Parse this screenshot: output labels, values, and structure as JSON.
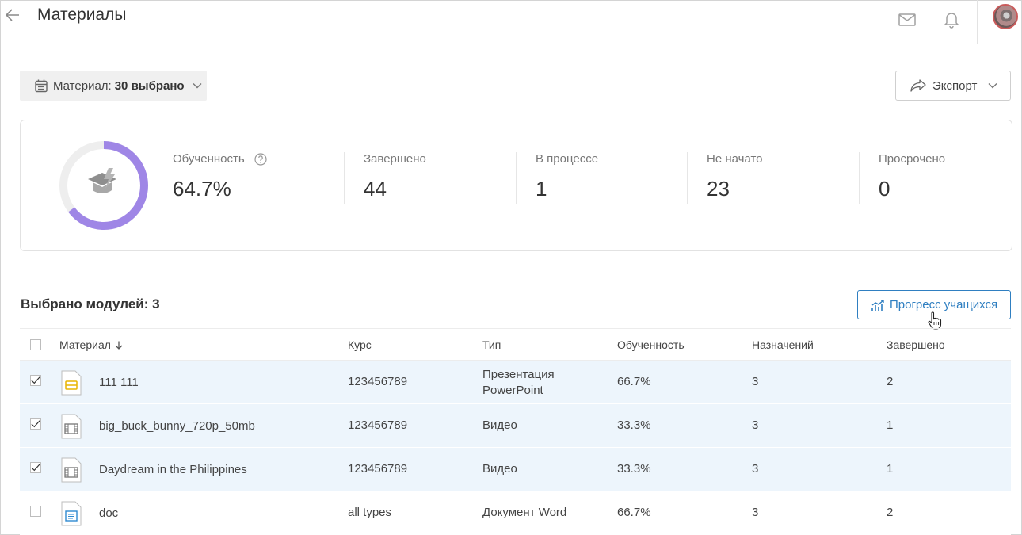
{
  "header": {
    "title": "Материалы"
  },
  "filter": {
    "label": "Материал:",
    "value": "30 выбрано"
  },
  "export": {
    "label": "Экспорт"
  },
  "stats": {
    "progress": {
      "label": "Обученность",
      "value": "64.7%",
      "fraction": 0.647
    },
    "completed": {
      "label": "Завершено",
      "value": "44"
    },
    "in_progress": {
      "label": "В процессе",
      "value": "1"
    },
    "not_started": {
      "label": "Не начато",
      "value": "23"
    },
    "overdue": {
      "label": "Просрочено",
      "value": "0"
    }
  },
  "modules": {
    "title": "Выбрано модулей: 3",
    "progress_button": "Прогресс учащихся"
  },
  "table": {
    "columns": {
      "material": "Материал",
      "course": "Курс",
      "type": "Тип",
      "progress": "Обученность",
      "assigned": "Назначений",
      "completed": "Завершено"
    },
    "rows": [
      {
        "name": "111 111",
        "course": "123456789",
        "type_line1": "Презентация",
        "type_line2": "PowerPoint",
        "progress": "66.7%",
        "assigned": "3",
        "completed": "2",
        "checked": true,
        "icon": "presentation-icon"
      },
      {
        "name": "big_buck_bunny_720p_50mb",
        "course": "123456789",
        "type_line1": "Видео",
        "type_line2": "",
        "progress": "33.3%",
        "assigned": "3",
        "completed": "1",
        "checked": true,
        "icon": "video-icon"
      },
      {
        "name": "Daydream in the Philippines",
        "course": "123456789",
        "type_line1": "Видео",
        "type_line2": "",
        "progress": "33.3%",
        "assigned": "3",
        "completed": "1",
        "checked": true,
        "icon": "video-icon"
      },
      {
        "name": "doc",
        "course": "all types",
        "type_line1": "Документ Word",
        "type_line2": "",
        "progress": "66.7%",
        "assigned": "3",
        "completed": "2",
        "checked": false,
        "icon": "word-document-icon"
      }
    ]
  },
  "colors": {
    "accent": "#2f7fc1",
    "ring": "#9f86e6",
    "ring_track": "#eeeeee",
    "selected_row": "#edf5fc"
  }
}
